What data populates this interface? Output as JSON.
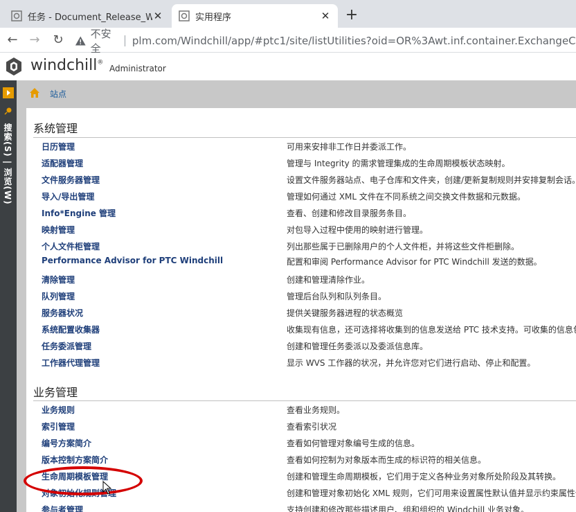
{
  "browser": {
    "tabs": [
      {
        "title": "任务 - Document_Release_WF_",
        "active": false
      },
      {
        "title": "实用程序",
        "active": true
      }
    ],
    "new_tab_label": "+",
    "address": {
      "security_label": "不安全",
      "url": "plm.com/Windchill/app/#ptc1/site/listUtilities?oid=OR%3Awt.inf.container.ExchangeContainer"
    }
  },
  "app": {
    "brand": "windchill",
    "brand_mark": "®",
    "user": "Administrator",
    "sidebar_label": "搜索(S) | 浏览(W)",
    "breadcrumb": "站点"
  },
  "sections": [
    {
      "title": "系统管理",
      "rows": [
        {
          "name": "日历管理",
          "desc": "可用来安排非工作日并委派工作。"
        },
        {
          "name": "适配器管理",
          "desc": "管理与 Integrity 的需求管理集成的生命周期模板状态映射。"
        },
        {
          "name": "文件服务器管理",
          "desc": "设置文件服务器站点、电子仓库和文件夹，创建/更新复制规则并安排复制会话。"
        },
        {
          "name": "导入/导出管理",
          "desc": "管理如何通过 XML 文件在不同系统之间交换文件数据和元数据。"
        },
        {
          "name": "Info*Engine 管理",
          "desc": "查看、创建和修改目录服务条目。"
        },
        {
          "name": "映射管理",
          "desc": "对包导入过程中使用的映射进行管理。"
        },
        {
          "name": "个人文件柜管理",
          "desc": "列出那些属于已删除用户的个人文件柜，并将这些文件柜删除。"
        },
        {
          "name": "Performance Advisor for PTC Windchill",
          "desc": "配置和审阅 Performance Advisor for PTC Windchill 发送的数据。"
        },
        {
          "name": "清除管理",
          "desc": "创建和管理清除作业。"
        },
        {
          "name": "队列管理",
          "desc": "管理后台队列和队列条目。"
        },
        {
          "name": "服务器状况",
          "desc": "提供关键服务器进程的状态概览"
        },
        {
          "name": "系统配置收集器",
          "desc": "收集现有信息，还可选择将收集到的信息发送给 PTC 技术支持。可收集的信息包"
        },
        {
          "name": "任务委派管理",
          "desc": "创建和管理任务委派以及委派信息库。"
        },
        {
          "name": "工作器代理管理",
          "desc": "显示 WVS 工作器的状况，并允许您对它们进行启动、停止和配置。"
        }
      ]
    },
    {
      "title": "业务管理",
      "rows": [
        {
          "name": "业务规则",
          "desc": "查看业务规则。"
        },
        {
          "name": "索引管理",
          "desc": "查看索引状况"
        },
        {
          "name": "编号方案简介",
          "desc": "查看如何管理对象编号生成的信息。"
        },
        {
          "name": "版本控制方案简介",
          "desc": "查看如何控制为对象版本而生成的标识符的相关信息。"
        },
        {
          "name": "生命周期模板管理",
          "desc": "创建和管理生命周期模板，它们用于定义各种业务对象所处阶段及其转换。"
        },
        {
          "name": "对象初始化规则管理",
          "desc": "创建和管理对象初始化 XML 规则，它们可用来设置属性默认值并显示约束属性值"
        },
        {
          "name": "参与者管理",
          "desc": "支持创建和修改那些描述用户、组和组织的 Windchill 业务对象。"
        }
      ]
    }
  ],
  "colors": {
    "link": "#1f3f7a",
    "annotation": "#d40000",
    "sidebar": "#3c4043",
    "accent": "#e69b00"
  }
}
